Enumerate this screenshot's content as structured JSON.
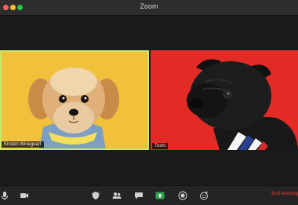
{
  "window": {
    "title": "Zoom"
  },
  "participants": [
    {
      "name": "Kirsten Winegeart",
      "bg": "#f1c13b",
      "active_speaker": true,
      "speaker_border": "#c6e96a"
    },
    {
      "name": "Toshi",
      "bg": "#e22b24",
      "active_speaker": false
    }
  ],
  "toolbar": {
    "items": [
      {
        "icon": "microphone-icon"
      },
      {
        "icon": "video-camera-icon"
      },
      {
        "icon": "security-shield-icon"
      },
      {
        "icon": "participants-icon"
      },
      {
        "icon": "chat-icon"
      },
      {
        "icon": "share-screen-icon",
        "color": "#2da44e"
      },
      {
        "icon": "record-icon"
      },
      {
        "icon": "reactions-icon"
      }
    ],
    "end_label": "End Meeting"
  },
  "colors": {
    "end": "#e53935",
    "accent_green": "#2da44e"
  }
}
